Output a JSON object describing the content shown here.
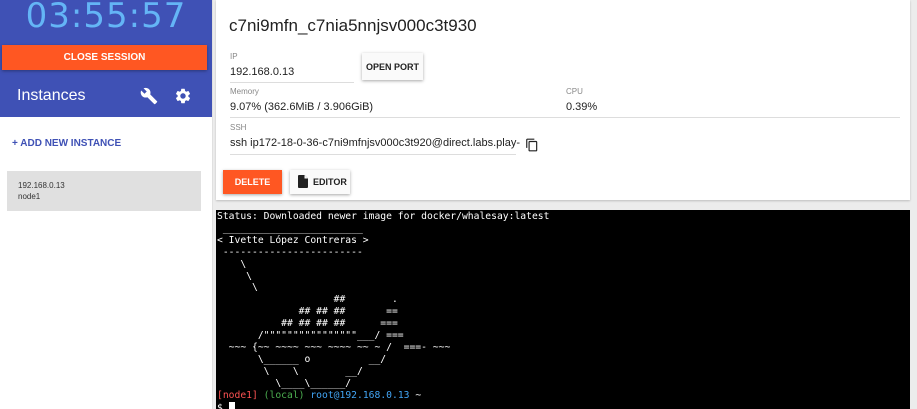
{
  "session": {
    "timer": "03:55:57",
    "close_label": "CLOSE SESSION",
    "instances_title": "Instances",
    "settings_icon": "gear-icon",
    "tools_icon": "wrench-icon",
    "add_instance_label": "+ ADD NEW INSTANCE"
  },
  "instances": [
    {
      "ip": "192.168.0.13",
      "name": "node1"
    }
  ],
  "details": {
    "title": "c7ni9mfn_c7nia5nnjsv000c3t930",
    "ip_label": "IP",
    "ip_value": "192.168.0.13",
    "open_port_label": "OPEN PORT",
    "memory_label": "Memory",
    "memory_value": "9.07% (362.6MiB / 3.906GiB)",
    "cpu_label": "CPU",
    "cpu_value": "0.39%",
    "ssh_label": "SSH",
    "ssh_value": "ssh ip172-18-0-36-c7ni9mfnjsv000c3t920@direct.labs.play-",
    "delete_label": "DELETE",
    "editor_label": "EDITOR"
  },
  "colors": {
    "primary": "#3f51b5",
    "accent": "#ff5722",
    "timer": "#64b5f6",
    "terminal_bg": "#000000"
  },
  "terminal": {
    "status_line": "Status: Downloaded newer image for docker/whalesay:latest",
    "art": " ________________________ \n< Ivette López Contreras >\n ------------------------ \n    \\\n     \\\n      \\\n                    ##        .\n              ## ## ##       ==\n           ## ## ## ##      ===\n       /\"\"\"\"\"\"\"\"\"\"\"\"\"\"\"\"___/ ===\n  ~~~ {~~ ~~~~ ~~~ ~~~~ ~~ ~ /  ===- ~~~\n       \\______ o          __/\n        \\    \\        __/\n          \\____\\______/",
    "prompt_node": "[node1]",
    "prompt_local": "(local)",
    "prompt_user": "root@192.168.0.13",
    "prompt_dir": "~",
    "prompt_symbol": "$"
  }
}
